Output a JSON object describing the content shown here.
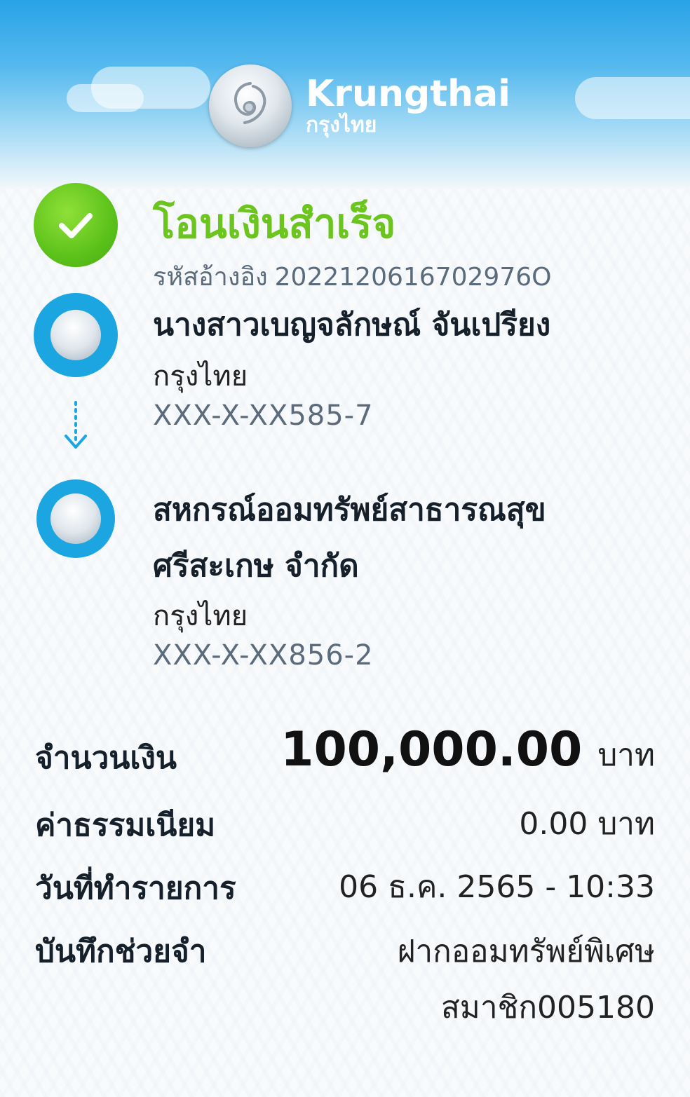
{
  "brand": {
    "name_en": "Krungthai",
    "name_th": "กรุงไทย"
  },
  "status": {
    "title": "โอนเงินสำเร็จ",
    "ref_label": "รหัสอ้างอิง",
    "ref_number": "2022120616702976O"
  },
  "sender": {
    "name": "นางสาวเบญจลักษณ์ จันเปรียง",
    "bank": "กรุงไทย",
    "account": "XXX-X-XX585-7"
  },
  "receiver": {
    "name_line1": "สหกรณ์ออมทรัพย์สาธารณสุข",
    "name_line2": "ศรีสะเกษ จำกัด",
    "bank": "กรุงไทย",
    "account": "XXX-X-XX856-2"
  },
  "details": {
    "amount_label": "จำนวนเงิน",
    "amount_value": "100,000.00",
    "amount_unit": "บาท",
    "fee_label": "ค่าธรรมเนียม",
    "fee_value": "0.00 บาท",
    "date_label": "วันที่ทำรายการ",
    "date_value": "06 ธ.ค. 2565 - 10:33",
    "memo_label": "บันทึกช่วยจำ",
    "memo_line1": "ฝากออมทรัพย์พิเศษ",
    "memo_line2": "สมาชิก005180"
  },
  "colors": {
    "success_green": "#6cc51e",
    "brand_blue": "#1ba5e1"
  },
  "icons": {
    "success": "check-circle-icon",
    "bank": "krungthai-bank-icon",
    "arrow": "arrow-down-dotted-icon"
  }
}
